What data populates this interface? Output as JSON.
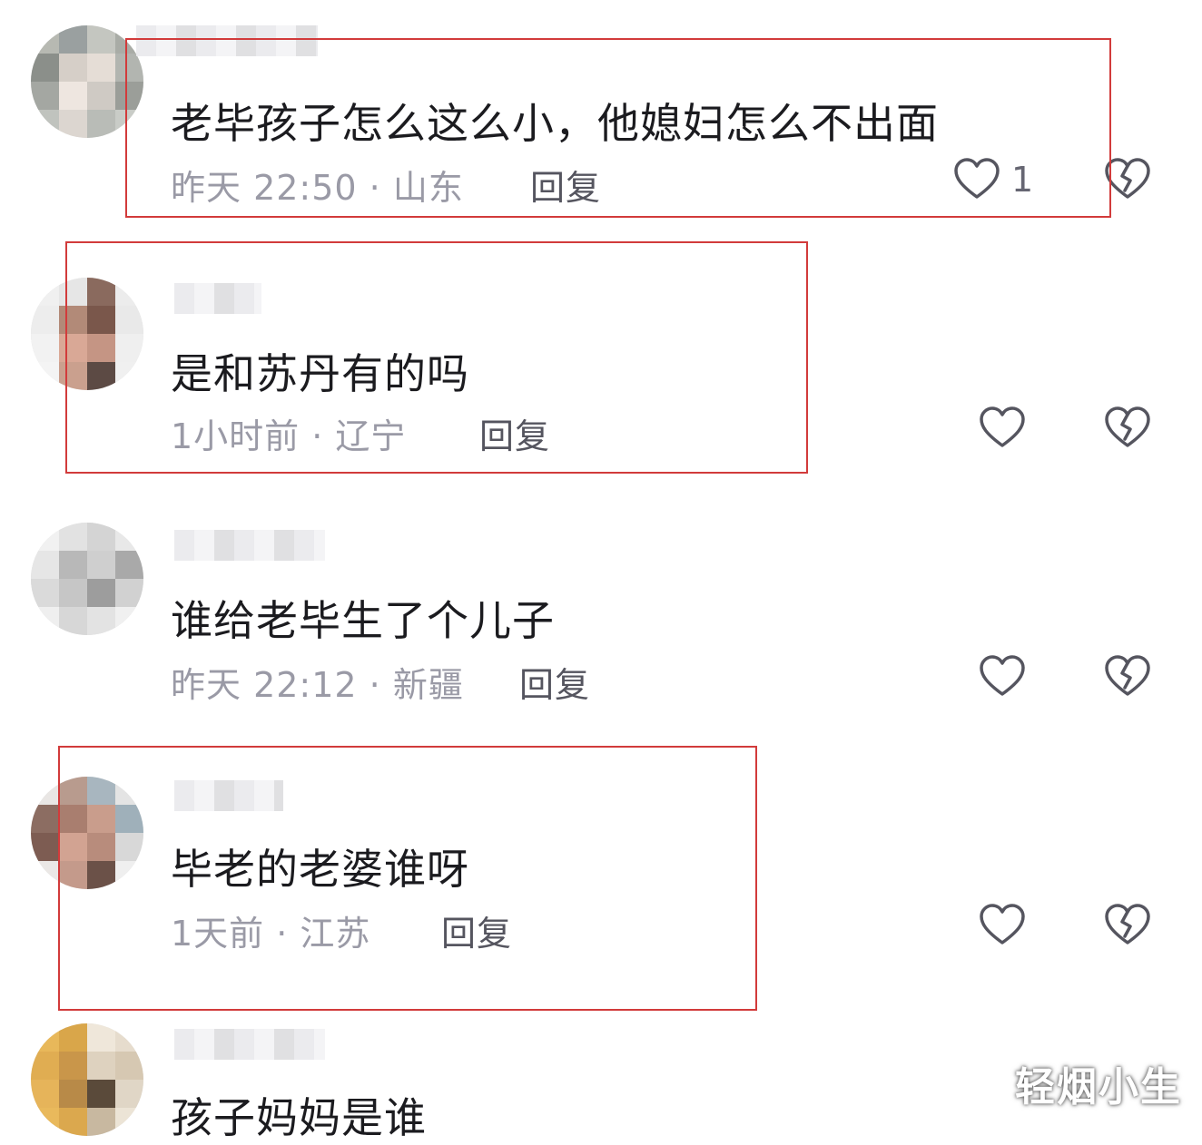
{
  "comments": [
    {
      "text": "老毕孩子怎么这么小，他媳妇怎么不出面",
      "meta": "昨天 22:50 · 山东",
      "reply": "回复",
      "likes": "1",
      "highlighted": true
    },
    {
      "text": "是和苏丹有的吗",
      "meta": "1小时前 · 辽宁",
      "reply": "回复",
      "likes": "",
      "highlighted": true
    },
    {
      "text": "谁给老毕生了个儿子",
      "meta": "昨天 22:12 · 新疆",
      "reply": "回复",
      "likes": "",
      "highlighted": false
    },
    {
      "text": "毕老的老婆谁呀",
      "meta": "1天前 · 江苏",
      "reply": "回复",
      "likes": "",
      "highlighted": true
    },
    {
      "text": "孩子妈妈是谁",
      "meta": "",
      "reply": "",
      "likes": "",
      "highlighted": false
    }
  ],
  "watermark": "轻烟小生",
  "colors": {
    "highlight_border": "#d23b3b",
    "text": "#1b1b1f",
    "meta": "#9a9aa6",
    "icon": "#55555f"
  },
  "icons": {
    "like": "heart-outline-icon",
    "dislike": "broken-heart-icon"
  }
}
